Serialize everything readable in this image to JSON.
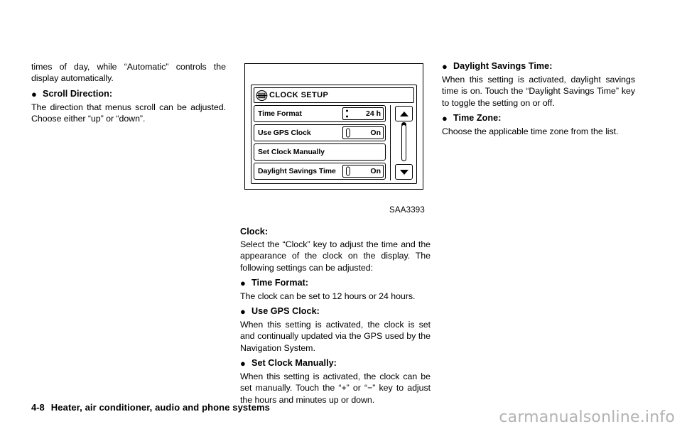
{
  "left_column": {
    "continuation_paragraph": "times of day, while “Automatic” controls the display automatically.",
    "bullets": [
      {
        "dot": "●",
        "label": "Scroll Direction:",
        "body": "The direction that menus scroll can be adjusted. Choose either “up” or “down”."
      }
    ]
  },
  "figure": {
    "caption": "SAA3393",
    "screen": {
      "title": "CLOCK SETUP",
      "title_icon": "clock-setup-icon",
      "rows": [
        {
          "label": "Time Format",
          "value": "24 h",
          "marker": "colon"
        },
        {
          "label": "Use GPS Clock",
          "value": "On",
          "marker": "pill"
        },
        {
          "label": "Set Clock Manually",
          "value": "",
          "marker": "none"
        },
        {
          "label": "Daylight Savings Time",
          "value": "On",
          "marker": "pill"
        }
      ],
      "scrollbar": {
        "up_icon": "triangle-up-icon",
        "down_icon": "triangle-down-icon"
      }
    }
  },
  "mid_column": {
    "heading": "Clock:",
    "intro": "Select the “Clock” key to adjust the time and the appearance of the clock on the display. The following settings can be adjusted:",
    "bullets": [
      {
        "dot": "●",
        "label": "Time Format:",
        "body": "The clock can be set to 12 hours or 24 hours."
      },
      {
        "dot": "●",
        "label": "Use GPS Clock:",
        "body": "When this setting is activated, the clock is set and continually updated via the GPS used by the Navigation System."
      },
      {
        "dot": "●",
        "label": "Set Clock Manually:",
        "body": "When this setting is activated, the clock can be set manually. Touch the “+” or “−” key to adjust the hours and minutes up or down."
      }
    ]
  },
  "right_column": {
    "bullets": [
      {
        "dot": "●",
        "label": "Daylight Savings Time:",
        "body": "When this setting is activated, daylight savings time is on. Touch the “Daylight Savings Time” key to toggle the setting on or off."
      },
      {
        "dot": "●",
        "label": "Time Zone:",
        "body": "Choose the applicable time zone from the list."
      }
    ]
  },
  "footer": {
    "page_number": "4-8",
    "section_title": "Heater, air conditioner, audio and phone systems"
  },
  "watermark": {
    "text": "carmanualsonline.info",
    "color": "#b3b3b3"
  }
}
